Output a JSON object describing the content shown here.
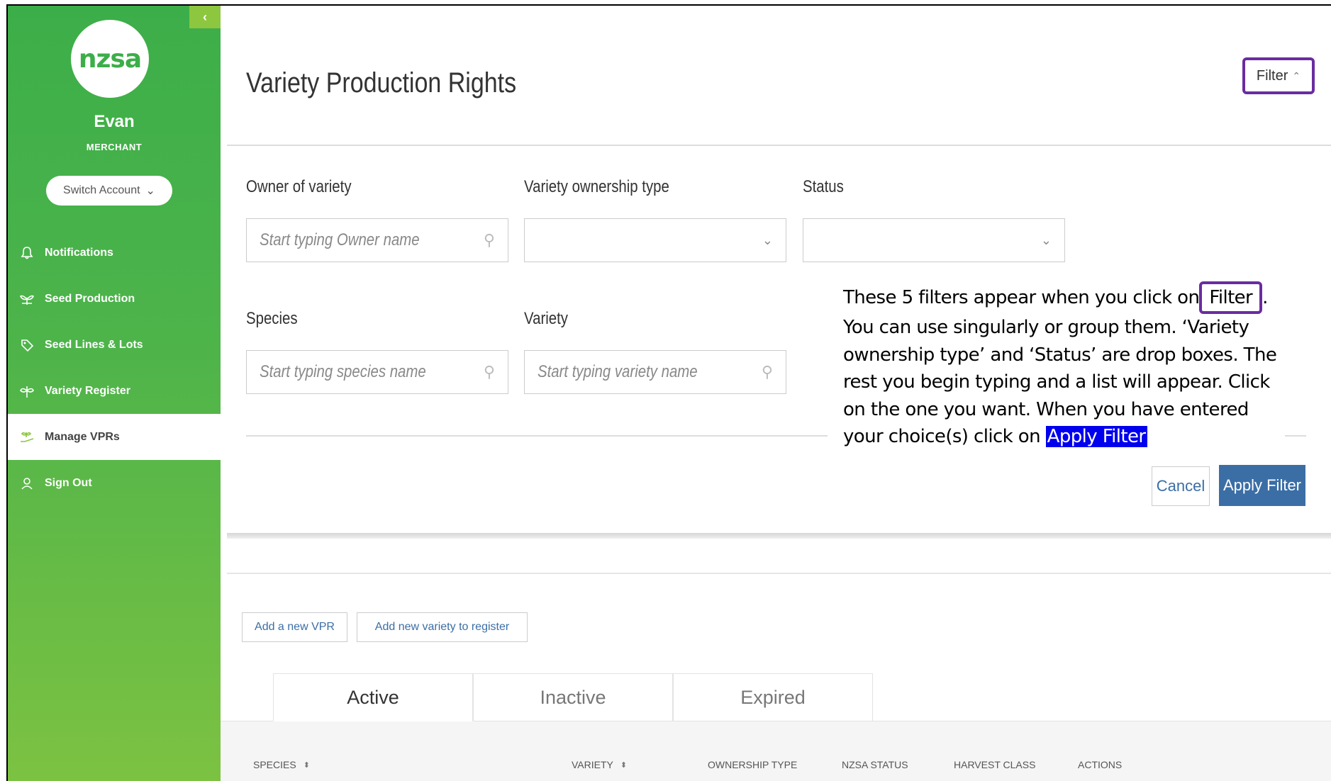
{
  "sidebar": {
    "collapse_icon": "chevron-left-icon",
    "logo_text": "nzsa",
    "user_name": "Evan",
    "user_role": "MERCHANT",
    "switch_label": "Switch Account",
    "items": [
      {
        "label": "Notifications",
        "icon": "bell-icon"
      },
      {
        "label": "Seed Production",
        "icon": "seedling-icon"
      },
      {
        "label": "Seed Lines & Lots",
        "icon": "tag-icon"
      },
      {
        "label": "Variety Register",
        "icon": "sprout-icon"
      },
      {
        "label": "Manage VPRs",
        "icon": "hand-plant-icon"
      },
      {
        "label": "Sign Out",
        "icon": "user-icon"
      }
    ]
  },
  "main": {
    "title": "Variety Production Rights",
    "filter_toggle": "Filter"
  },
  "filters": {
    "owner": {
      "label": "Owner of variety",
      "placeholder": "Start typing Owner name"
    },
    "ownership_type": {
      "label": "Variety ownership type",
      "value": ""
    },
    "status": {
      "label": "Status",
      "value": ""
    },
    "species": {
      "label": "Species",
      "placeholder": "Start typing species name"
    },
    "variety": {
      "label": "Variety",
      "placeholder": "Start typing variety name"
    },
    "cancel": "Cancel",
    "apply": "Apply Filter"
  },
  "annotation": {
    "part1": "These 5 filters appear when you click on",
    "filter_word": "Filter",
    "part2": ". You can use singularly or group them. ‘Variety ownership type’ and ‘Status’ are drop boxes. The rest you begin typing and a list will appear. Click on the one you want. When you have entered your choice(s) click on ",
    "apply_word": "Apply Filter"
  },
  "actions": {
    "add_vpr": "Add a new VPR",
    "add_variety": "Add new variety to register"
  },
  "tabs": [
    "Active",
    "Inactive",
    "Expired"
  ],
  "table": {
    "columns": [
      "SPECIES",
      "VARIETY",
      "OWNERSHIP TYPE",
      "NZSA STATUS",
      "HARVEST CLASS",
      "ACTIONS"
    ]
  },
  "colors": {
    "brand_green": "#3cae49",
    "accent_blue": "#3b6ea5",
    "highlight_purple": "#6a2ca0"
  }
}
